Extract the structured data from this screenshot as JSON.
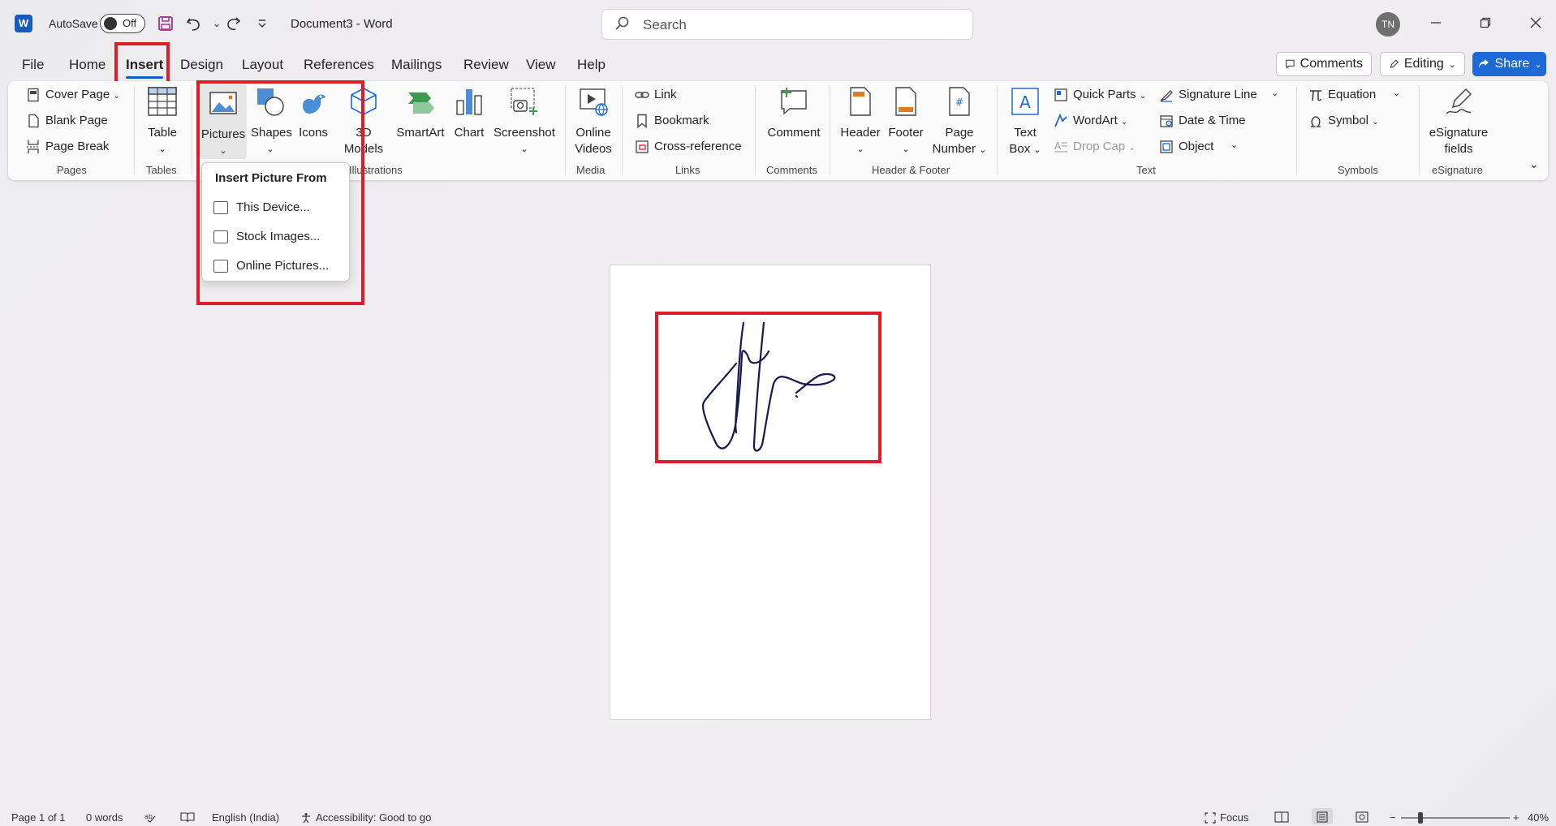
{
  "titlebar": {
    "autosave_label": "AutoSave",
    "autosave_state": "Off",
    "doc_title": "Document3  -  Word",
    "search_placeholder": "Search",
    "avatar": "TN"
  },
  "tabs": [
    "File",
    "Home",
    "Insert",
    "Design",
    "Layout",
    "References",
    "Mailings",
    "Review",
    "View",
    "Help"
  ],
  "actions": {
    "comments": "Comments",
    "editing": "Editing",
    "share": "Share"
  },
  "ribbon": {
    "pages": {
      "cover_page": "Cover Page",
      "blank_page": "Blank Page",
      "page_break": "Page Break",
      "label": "Pages"
    },
    "tables": {
      "table": "Table",
      "label": "Tables"
    },
    "illustrations": {
      "pictures": "Pictures",
      "shapes": "Shapes",
      "icons": "Icons",
      "models_top": "3D",
      "models_bottom": "Models",
      "smartart": "SmartArt",
      "chart": "Chart",
      "screenshot": "Screenshot",
      "label": "Illustrations"
    },
    "media": {
      "online_top": "Online",
      "online_bottom": "Videos",
      "label": "Media"
    },
    "links": {
      "link": "Link",
      "bookmark": "Bookmark",
      "cross_reference": "Cross-reference",
      "label": "Links"
    },
    "comments": {
      "comment": "Comment",
      "label": "Comments"
    },
    "header_footer": {
      "header": "Header",
      "footer": "Footer",
      "page_top": "Page",
      "page_bottom": "Number",
      "label": "Header & Footer"
    },
    "text": {
      "textbox_top": "Text",
      "textbox_bottom": "Box",
      "quick_parts": "Quick Parts",
      "wordart": "WordArt",
      "drop_cap": "Drop Cap",
      "signature_line": "Signature Line",
      "date_time": "Date & Time",
      "object": "Object",
      "label": "Text"
    },
    "symbols": {
      "equation": "Equation",
      "symbol": "Symbol",
      "label": "Symbols"
    },
    "esignature": {
      "top": "eSignature",
      "bottom": "fields",
      "label": "eSignature"
    }
  },
  "dropdown": {
    "title": "Insert Picture From",
    "items": [
      "This Device...",
      "Stock Images...",
      "Online Pictures..."
    ]
  },
  "statusbar": {
    "page": "Page 1 of 1",
    "words": "0 words",
    "language": "English (India)",
    "accessibility": "Accessibility: Good to go",
    "focus": "Focus",
    "zoom": "40%"
  },
  "colors": {
    "accent": "#185abd",
    "highlight": "#e21b2b",
    "signature_ink": "#1a1650"
  }
}
